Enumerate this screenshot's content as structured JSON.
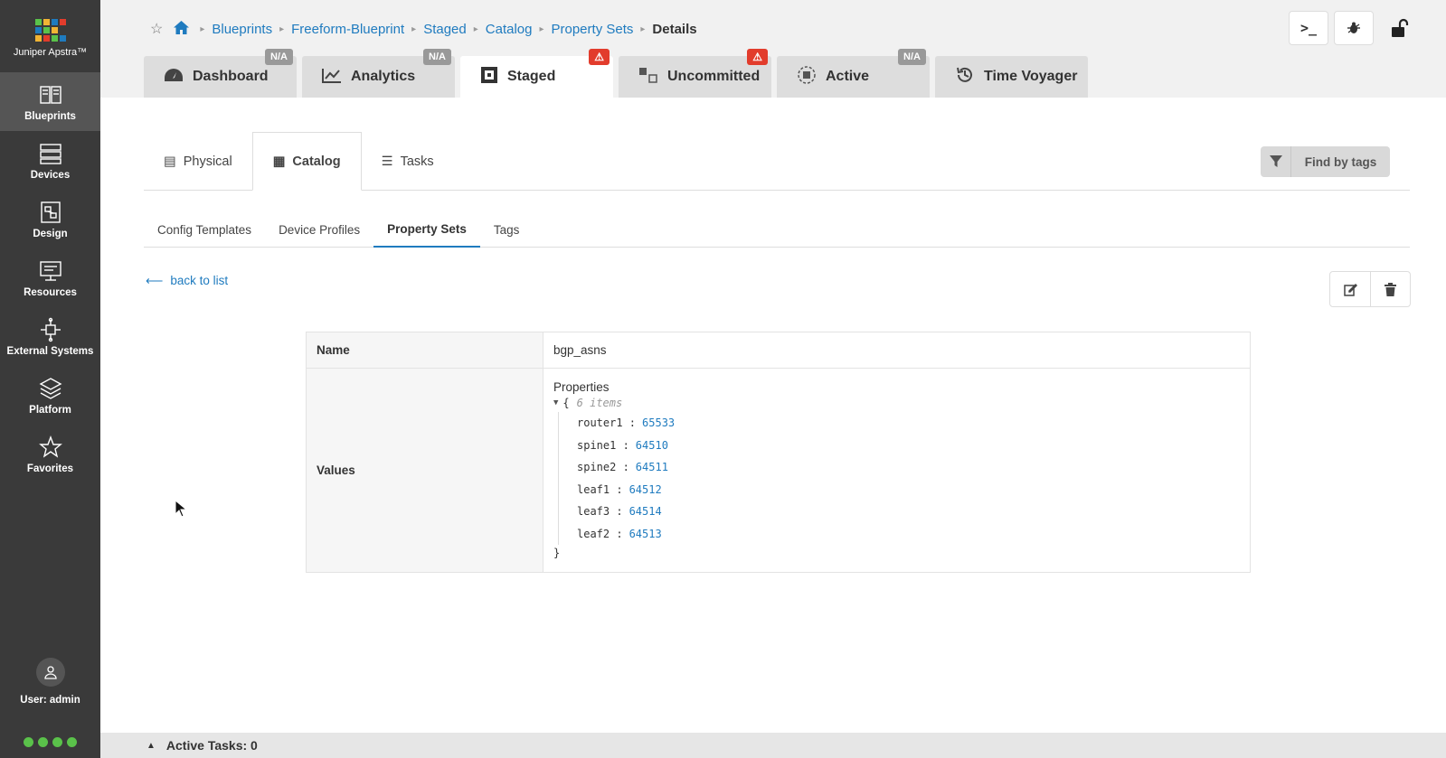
{
  "app": {
    "name": "Juniper Apstra™"
  },
  "sidebar": {
    "items": [
      {
        "label": "Blueprints",
        "active": true
      },
      {
        "label": "Devices"
      },
      {
        "label": "Design"
      },
      {
        "label": "Resources"
      },
      {
        "label": "External Systems"
      },
      {
        "label": "Platform"
      },
      {
        "label": "Favorites"
      }
    ],
    "user": "User: admin"
  },
  "breadcrumb": [
    "Blueprints",
    "Freeform-Blueprint",
    "Staged",
    "Catalog",
    "Property Sets"
  ],
  "breadcrumb_current": "Details",
  "tabs": [
    {
      "label": "Dashboard",
      "badge": "N/A"
    },
    {
      "label": "Analytics",
      "badge": "N/A"
    },
    {
      "label": "Staged",
      "badge": "⚠"
    },
    {
      "label": "Uncommitted",
      "badge": "⚠"
    },
    {
      "label": "Active",
      "badge": "N/A"
    },
    {
      "label": "Time Voyager"
    }
  ],
  "subtabs": [
    "Physical",
    "Catalog",
    "Tasks"
  ],
  "find_tags": "Find by tags",
  "catnav": [
    "Config Templates",
    "Device Profiles",
    "Property Sets",
    "Tags"
  ],
  "back_label": "back to list",
  "detail": {
    "name_label": "Name",
    "name_value": "bgp_asns",
    "values_label": "Values",
    "properties_label": "Properties",
    "open_brace": "{",
    "close_brace": "}",
    "count": "6 items",
    "items": [
      {
        "key": "router1 :",
        "value": "65533"
      },
      {
        "key": "spine1 :",
        "value": "64510"
      },
      {
        "key": "spine2 :",
        "value": "64511"
      },
      {
        "key": "leaf1 :",
        "value": "64512"
      },
      {
        "key": "leaf3 :",
        "value": "64514"
      },
      {
        "key": "leaf2 :",
        "value": "64513"
      }
    ]
  },
  "bottom": {
    "active_tasks": "Active Tasks: 0"
  },
  "colors": {
    "accent": "#1f7bbf",
    "sidebar": "#3a3a3a",
    "warn": "#e23c2c",
    "ok": "#5ac24a"
  },
  "icons": [
    "logo-icon",
    "blueprints-icon",
    "devices-icon",
    "design-icon",
    "resources-icon",
    "external-systems-icon",
    "platform-icon",
    "star-icon",
    "home-icon",
    "terminal-icon",
    "bug-icon",
    "unlock-icon",
    "edit-icon",
    "trash-icon",
    "filter-icon",
    "user-icon"
  ]
}
